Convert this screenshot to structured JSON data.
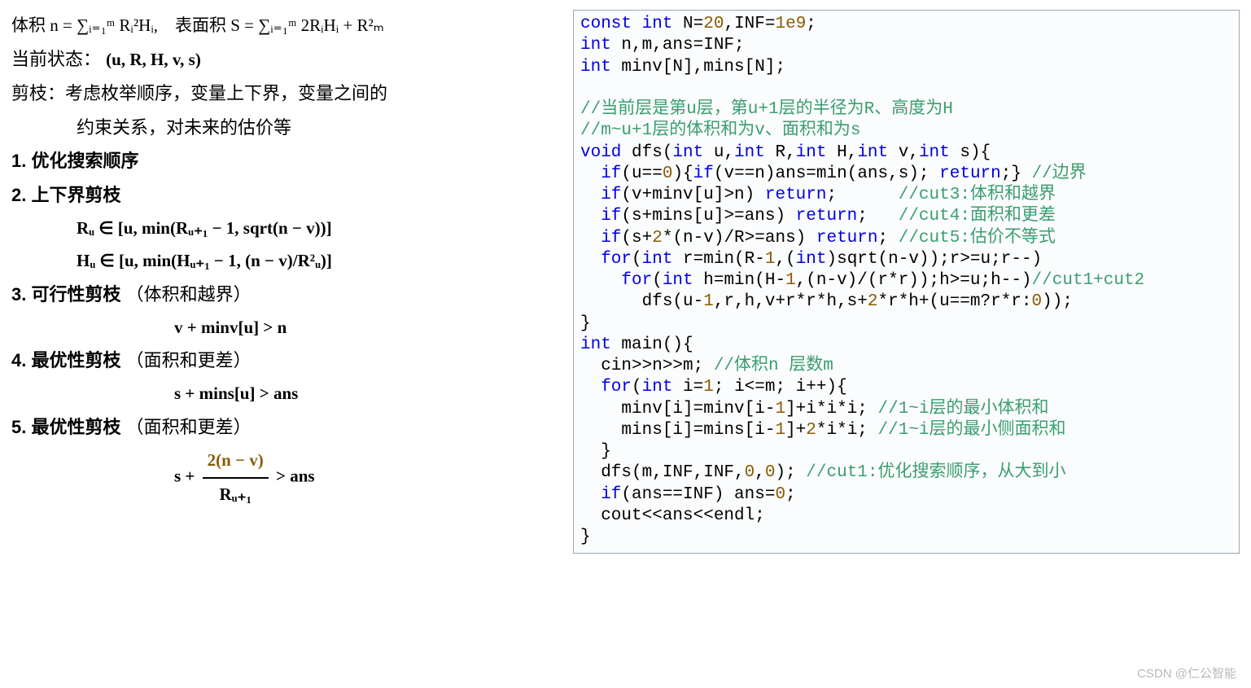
{
  "left": {
    "line_volume_surface": "体积 n = ∑ᵢ₌₁ᵐ Rᵢ²Hᵢ,　表面积 S = ∑ᵢ₌₁ᵐ 2RᵢHᵢ + R²ₘ",
    "line_state_label": "当前状态：",
    "line_state_tuple": "(u, R, H, v, s)",
    "line_prune_1": "剪枝：考虑枚举顺序，变量上下界，变量之间的",
    "line_prune_2": "约束关系，对未来的估价等",
    "h1": "1. 优化搜索顺序",
    "h2": "2. 上下界剪枝",
    "h2_eq1": "Rᵤ ∈ [u, min(Rᵤ₊₁ − 1, sqrt(n − v))]",
    "h2_eq2": "Hᵤ ∈ [u, min(Hᵤ₊₁ − 1, (n − v)/R²ᵤ)]",
    "h3_a": "3. 可行性剪枝",
    "h3_b": "（体积和越界）",
    "h3_eq": "v + minv[u] > n",
    "h4_a": "4. 最优性剪枝",
    "h4_b": "（面积和更差）",
    "h4_eq": "s + mins[u] > ans",
    "h5_a": "5. 最优性剪枝",
    "h5_b": "（面积和更差）",
    "h5_lhs": "s +",
    "h5_num": "2(n − v)",
    "h5_den": "Rᵤ₊₁",
    "h5_rhs": "> ans"
  },
  "code": {
    "l01a": "const",
    "l01b": " int",
    "l01c": " N=",
    "l01d": "20",
    "l01e": ",INF=",
    "l01f": "1e9",
    "l01g": ";",
    "l02a": "int",
    "l02b": " n,m,ans=INF;",
    "l03a": "int",
    "l03b": " minv[N],mins[N];",
    "l04": "",
    "l05": "//当前层是第u层，第u+1层的半径为R、高度为H",
    "l06": "//m~u+1层的体积和为v、面积和为s",
    "l07a": "void",
    "l07b": " dfs(",
    "l07c": "int",
    "l07d": " u,",
    "l07e": "int",
    "l07f": " R,",
    "l07g": "int",
    "l07h": " H,",
    "l07i": "int",
    "l07j": " v,",
    "l07k": "int",
    "l07l": " s){",
    "l08a": "  if",
    "l08b": "(u==",
    "l08c": "0",
    "l08d": "){",
    "l08e": "if",
    "l08f": "(v==n)ans=min(ans,s); ",
    "l08g": "return",
    "l08h": ";} ",
    "l08i": "//边界",
    "l09a": "  if",
    "l09b": "(v+minv[u]>n) ",
    "l09c": "return",
    "l09d": ";      ",
    "l09e": "//cut3:体积和越界",
    "l10a": "  if",
    "l10b": "(s+mins[u]>=ans) ",
    "l10c": "return",
    "l10d": ";   ",
    "l10e": "//cut4:面积和更差",
    "l11a": "  if",
    "l11b": "(s+",
    "l11c": "2",
    "l11d": "*(n-v)/R>=ans) ",
    "l11e": "return",
    "l11f": "; ",
    "l11g": "//cut5:估价不等式",
    "l12a": "  for",
    "l12b": "(",
    "l12c": "int",
    "l12d": " r=min(R-",
    "l12e": "1",
    "l12f": ",(",
    "l12g": "int",
    "l12h": ")sqrt(n-v));r>=u;r--)",
    "l13a": "    for",
    "l13b": "(",
    "l13c": "int",
    "l13d": " h=min(H-",
    "l13e": "1",
    "l13f": ",(n-v)/(r*r));h>=u;h--)",
    "l13g": "//cut1+cut2",
    "l14a": "      dfs(u-",
    "l14b": "1",
    "l14c": ",r,h,v+r*r*h,s+",
    "l14d": "2",
    "l14e": "*r*h+(u==m?r*r:",
    "l14f": "0",
    "l14g": "));",
    "l15": "}",
    "l16a": "int",
    "l16b": " main(){",
    "l17a": "  cin>>n>>m; ",
    "l17b": "//体积n 层数m",
    "l18a": "  for",
    "l18b": "(",
    "l18c": "int",
    "l18d": " i=",
    "l18e": "1",
    "l18f": "; i<=m; i++){",
    "l19a": "    minv[i]=minv[i-",
    "l19b": "1",
    "l19c": "]+i*i*i; ",
    "l19d": "//1~i层的最小体积和",
    "l20a": "    mins[i]=mins[i-",
    "l20b": "1",
    "l20c": "]+",
    "l20d": "2",
    "l20e": "*i*i; ",
    "l20f": "//1~i层的最小侧面积和",
    "l21": "  }",
    "l22a": "  dfs(m,INF,INF,",
    "l22b": "0",
    "l22c": ",",
    "l22d": "0",
    "l22e": "); ",
    "l22f": "//cut1:优化搜索顺序，从大到小",
    "l23a": "  if",
    "l23b": "(ans==INF) ans=",
    "l23c": "0",
    "l23d": ";",
    "l24": "  cout<<ans<<endl;",
    "l25": "}"
  },
  "watermark": "CSDN @仁公智能"
}
